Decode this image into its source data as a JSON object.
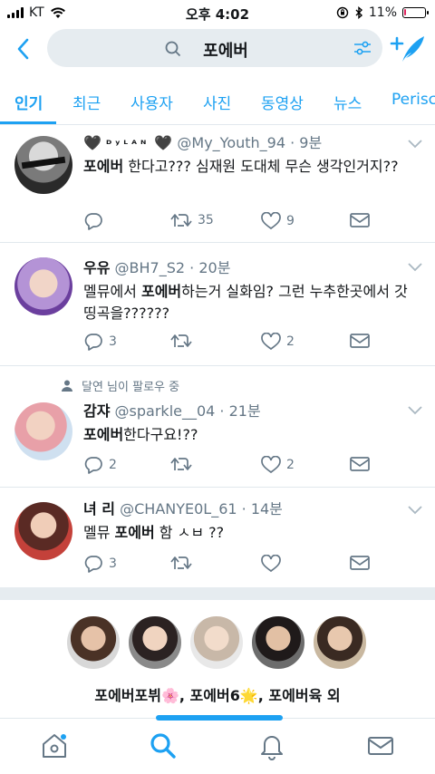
{
  "status_bar": {
    "carrier": "KT",
    "time": "오후 4:02",
    "battery_percent": "11%",
    "battery_level": 0.11
  },
  "search": {
    "query": "포에버"
  },
  "tabs": [
    {
      "label": "인기"
    },
    {
      "label": "최근"
    },
    {
      "label": "사용자"
    },
    {
      "label": "사진"
    },
    {
      "label": "동영상"
    },
    {
      "label": "뉴스"
    },
    {
      "label": "Periscope"
    }
  ],
  "tweets": [
    {
      "name": "ᴰʸᴸᴬᴺ",
      "handle": "@My_Youth_94 · 9분",
      "text_bold": "포에버",
      "text_rest": " 한다고??? 심재원 도대체 무슨 생각인거지??",
      "replies": "",
      "retweets": "35",
      "likes": "9"
    },
    {
      "name": "우유",
      "handle": "@BH7_S2 · 20분",
      "text_pre": "멜뮤에서 ",
      "text_bold": "포에버",
      "text_rest": "하는거 실화임? 그런 누추한곳에서 갓띵곡을??????",
      "replies": "3",
      "retweets": "",
      "likes": "2"
    },
    {
      "context": "달연 님이 팔로우 중",
      "name": "감쟈",
      "handle": "@sparkle__04 · 21분",
      "text_bold": "포에버",
      "text_rest": "한다구요!??",
      "replies": "2",
      "retweets": "",
      "likes": "2"
    },
    {
      "name": "녀 리",
      "handle": "@CHANYE0L_61 · 14분",
      "text_pre": "멜뮤 ",
      "text_bold": "포에버",
      "text_rest": " 함 ㅅㅂ ??",
      "replies": "3",
      "retweets": "",
      "likes": ""
    }
  ],
  "related": {
    "caption": "포에버포뷔🌸, 포에버6🌟, 포에버육 외"
  },
  "colors": {
    "accent": "#1da1f2",
    "secondary_text": "#657786",
    "divider": "#e1e8ed",
    "search_bg": "#e6ecf0"
  }
}
